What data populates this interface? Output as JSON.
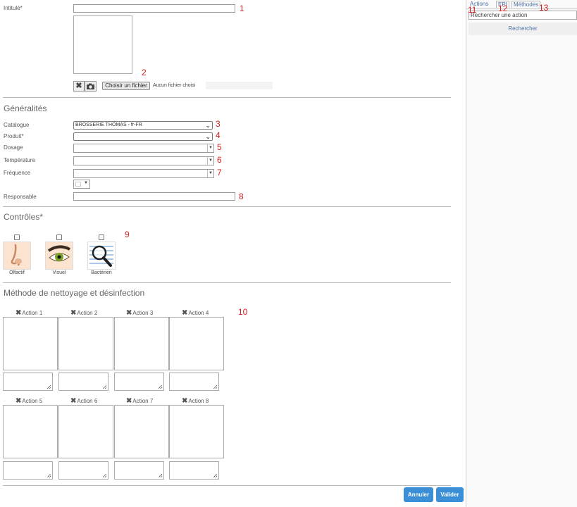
{
  "form": {
    "intitule_label": "Intitulé*",
    "choose_file_label": "Choisir un fichier",
    "no_file_text": "Aucun fichier choisi",
    "generalites_title": "Généralités",
    "catalogue_label": "Catalogue",
    "catalogue_value": "BROSSERIE THOMAS - fr-FR",
    "produit_label": "Produit*",
    "dosage_label": "Dosage",
    "temperature_label": "Température",
    "frequence_label": "Fréquence",
    "responsable_label": "Responsable",
    "controles_title": "Contrôles*",
    "controles": [
      {
        "label": "Olfactif",
        "icon": "nose-icon"
      },
      {
        "label": "Visuel",
        "icon": "eye-icon"
      },
      {
        "label": "Bactérien",
        "icon": "magnifier-icon"
      }
    ],
    "methode_title": "Méthode de nettoyage et désinfection",
    "actions": [
      "Action 1",
      "Action 2",
      "Action 3",
      "Action 4",
      "Action 5",
      "Action 6",
      "Action 7",
      "Action 8"
    ]
  },
  "annotations": [
    "1",
    "2",
    "3",
    "4",
    "5",
    "6",
    "7",
    "8",
    "9",
    "10",
    "11",
    "12",
    "13"
  ],
  "buttons": {
    "cancel": "Annuler",
    "validate": "Valider"
  },
  "right_panel": {
    "tabs": [
      "Actions",
      "EPI",
      "Méthodes"
    ],
    "search_value": "Rechercher une action",
    "search_button": "Rechercher"
  },
  "colors": {
    "accent": "#3b8fd6",
    "annotation": "#d32020"
  }
}
